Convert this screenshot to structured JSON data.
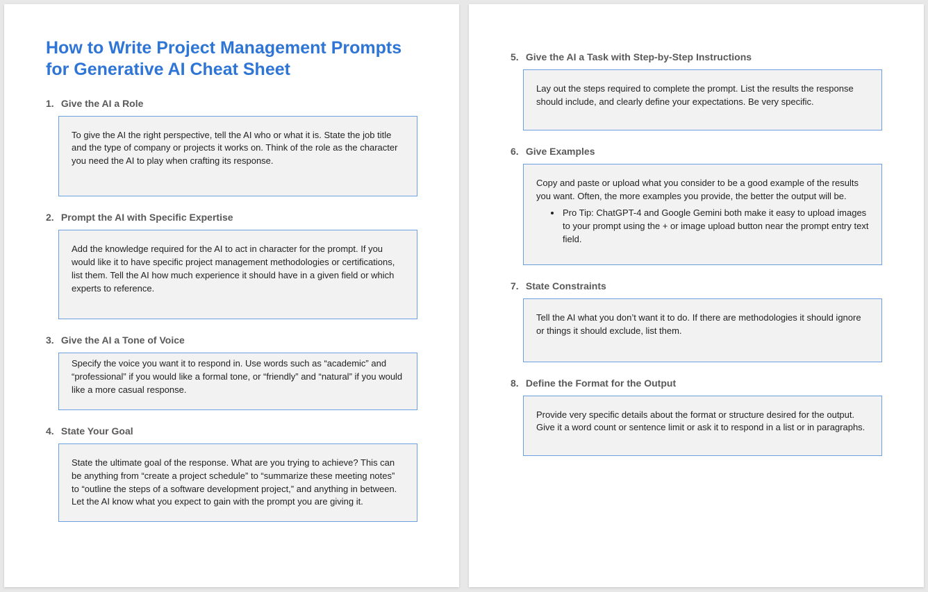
{
  "title": "How to Write Project Management Prompts for Generative AI Cheat Sheet",
  "sections": [
    {
      "num": "1.",
      "heading": "Give the AI a Role",
      "body": "To give the AI the right perspective, tell the AI who or what it is. State the job title and the type of company or projects it works on. Think of the role as the character you need the AI to play when crafting its response."
    },
    {
      "num": "2.",
      "heading": "Prompt the AI with Specific Expertise",
      "body": "Add the knowledge required for the AI to act in character for the prompt. If you would like it to have specific project management methodologies or certifications, list them. Tell the AI how much experience it should have in a given field or which experts to reference."
    },
    {
      "num": "3.",
      "heading": "Give the AI a Tone of Voice",
      "body": "Specify the voice you want it to respond in. Use words such as “academic” and “professional” if you would like a formal tone, or “friendly” and “natural” if you would like a more casual response."
    },
    {
      "num": "4.",
      "heading": "State Your Goal",
      "body": "State the ultimate goal of the response. What are you trying to achieve? This can be anything from “create a project schedule” to “summarize these meeting notes” to “outline the steps of a software development project,” and anything in between. Let the AI know what you expect to gain with the prompt you are giving it."
    },
    {
      "num": "5.",
      "heading": "Give the AI a Task with Step-by-Step Instructions",
      "body": "Lay out the steps required to complete the prompt. List the results the response should include, and clearly define your expectations. Be very specific."
    },
    {
      "num": "6.",
      "heading": "Give Examples",
      "body": "Copy and paste or upload what you consider to be a good example of the results you want. Often, the more examples you provide, the better the output will be.",
      "bullet": "Pro Tip: ChatGPT-4 and Google Gemini both make it easy to upload images to your prompt using the + or image upload button near the prompt entry text field."
    },
    {
      "num": "7.",
      "heading": "State Constraints",
      "body": "Tell the AI what you don’t want it to do. If there are methodologies it should ignore or things it should exclude, list them."
    },
    {
      "num": "8.",
      "heading": "Define the Format for the Output",
      "body": "Provide very specific details about the format or structure desired for the output. Give it a word count or sentence limit or ask it to respond in a list or in paragraphs."
    }
  ]
}
